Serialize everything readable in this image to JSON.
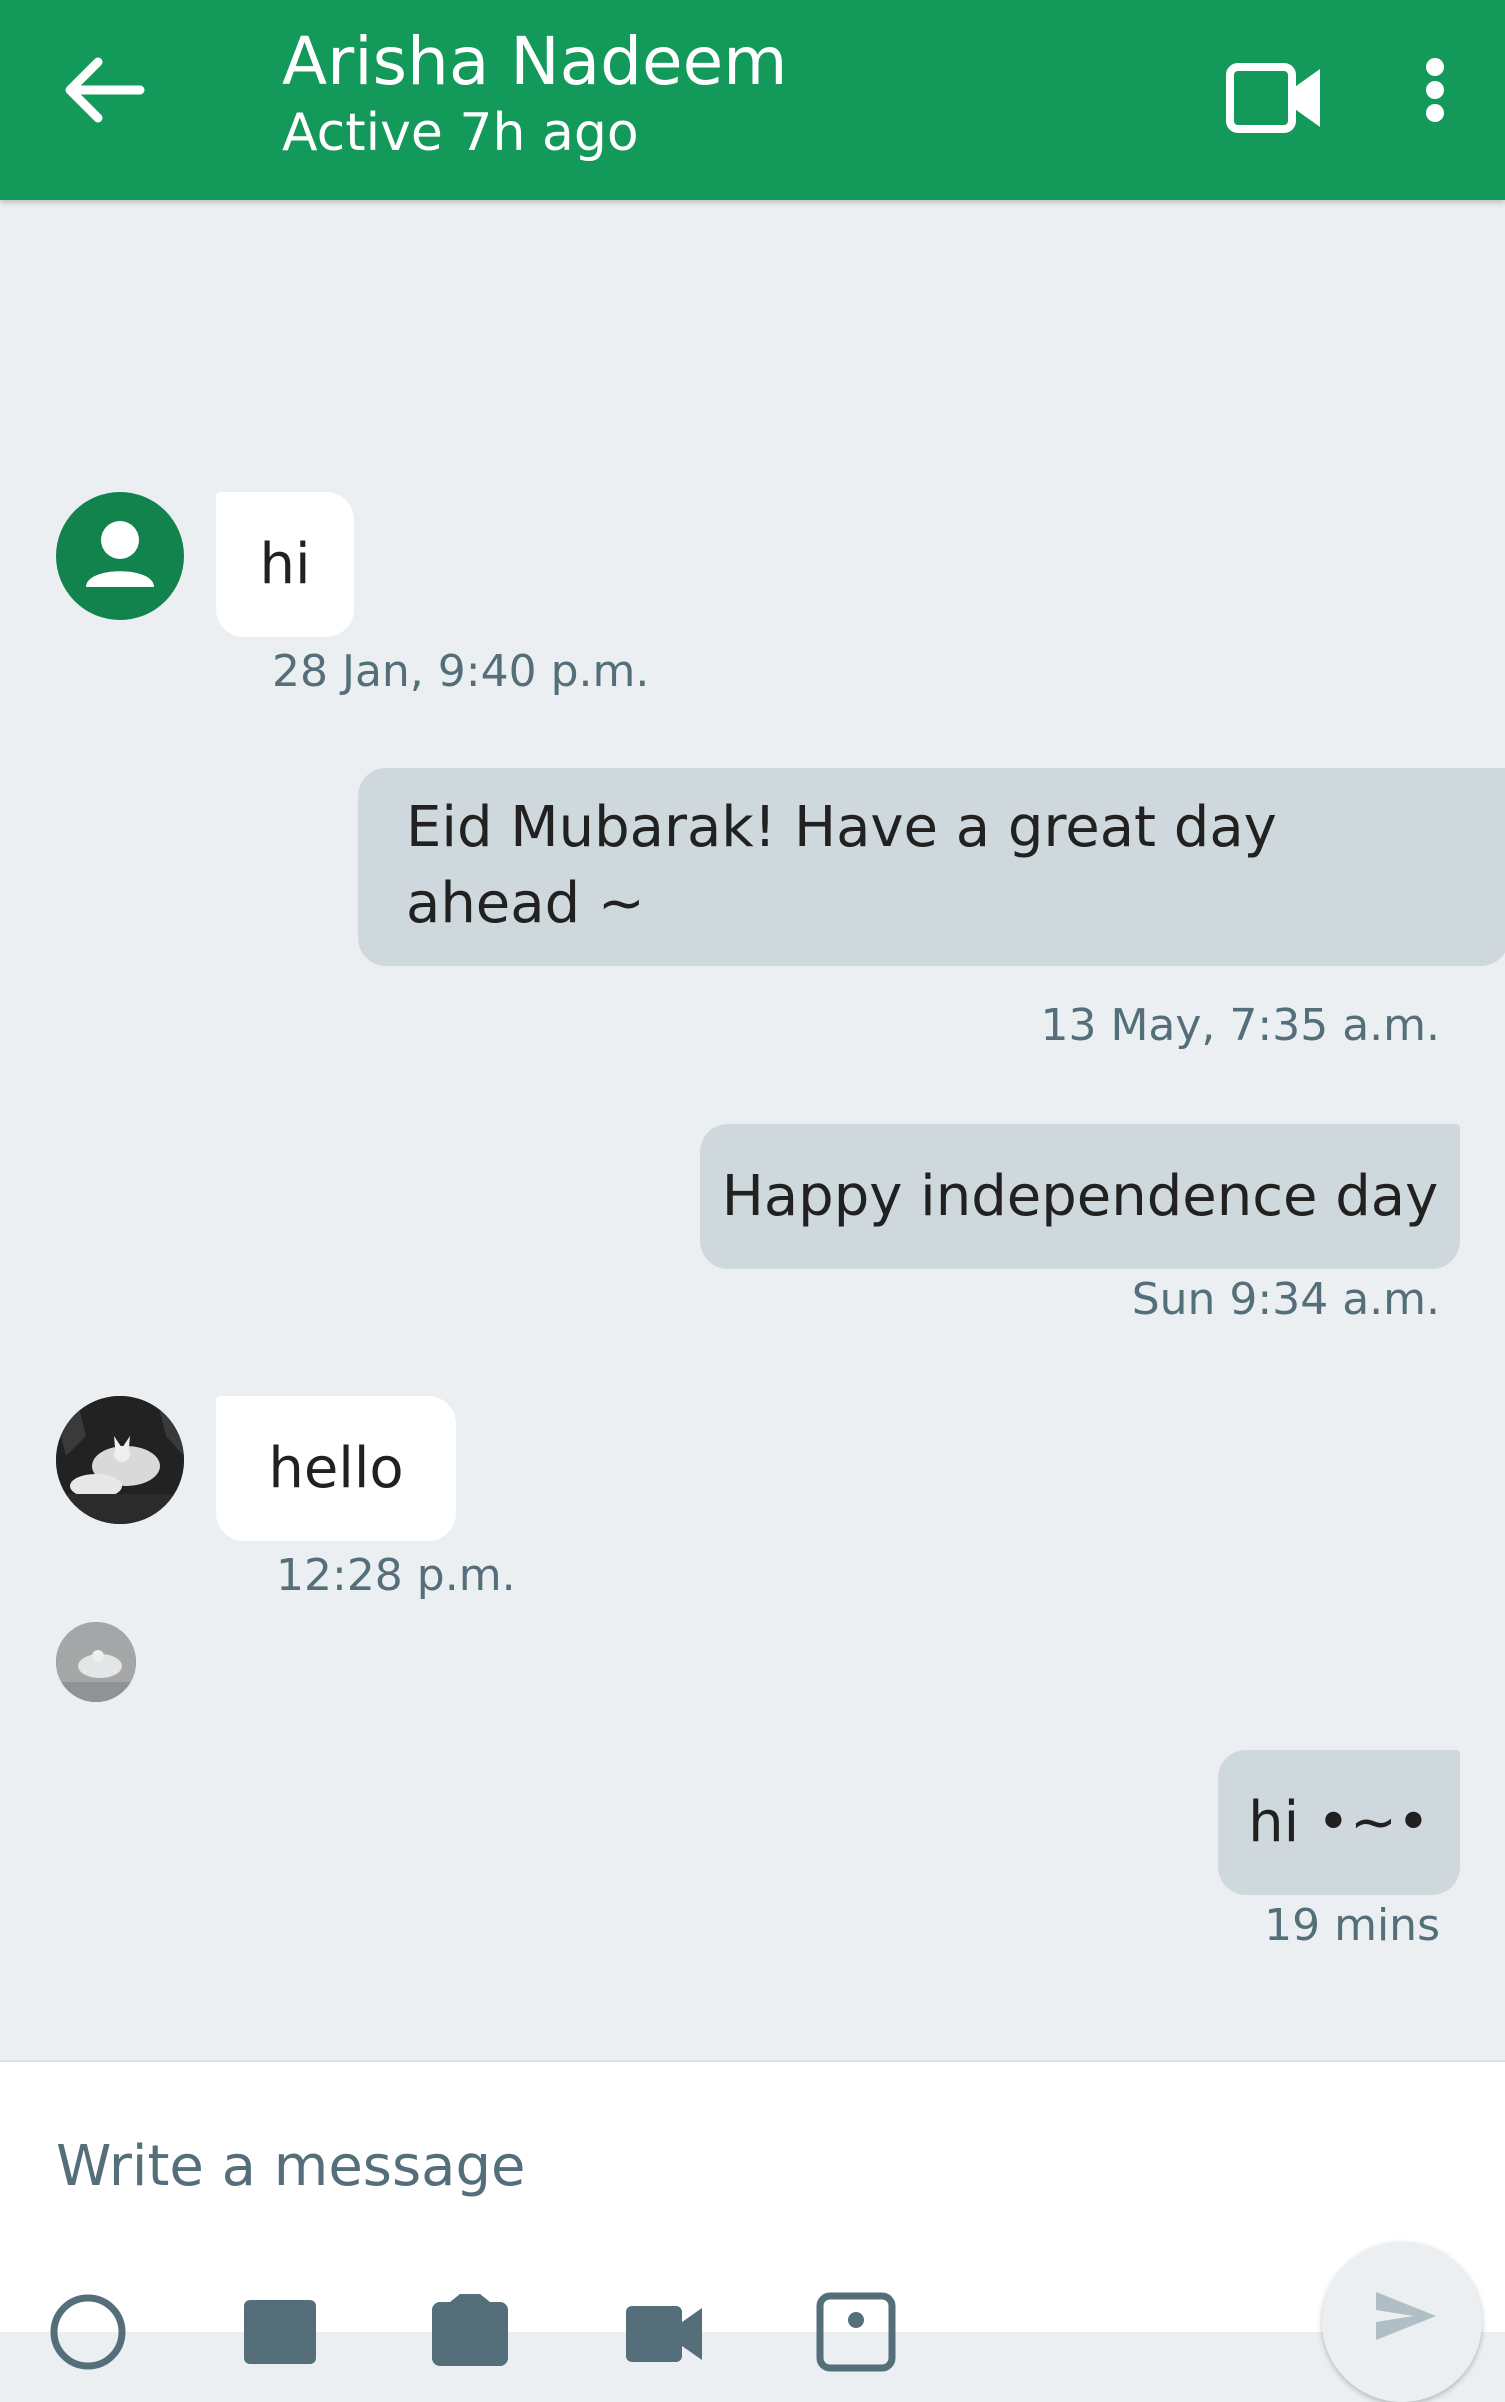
{
  "header": {
    "title": "Arisha Nadeem",
    "status": "Active 7h ago",
    "icons": [
      "back-arrow-icon",
      "video-call-icon",
      "more-vert-icon"
    ],
    "background_color": "#13995a"
  },
  "messages": [
    {
      "direction": "incoming",
      "text": "hi",
      "time": "28 Jan, 9:40 p.m.",
      "avatar": "person-avatar-icon"
    },
    {
      "direction": "outgoing",
      "text": "Eid Mubarak! Have a great day ahead ~",
      "time": "13 May, 7:35 a.m."
    },
    {
      "direction": "outgoing",
      "text": "Happy independence day",
      "time": "Sun 9:34 a.m."
    },
    {
      "direction": "incoming",
      "text": "hello",
      "time": "12:28 p.m.",
      "avatar": "wolf-photo-avatar"
    },
    {
      "direction": "outgoing",
      "text": "hi •~•",
      "time": "19 mins"
    }
  ],
  "composer": {
    "placeholder": "Write a message",
    "icons": [
      "emoji-icon",
      "gallery-icon",
      "camera-icon",
      "video-icon",
      "contact-icon",
      "send-icon"
    ]
  },
  "colors": {
    "incoming_bubble": "#ffffff",
    "outgoing_bubble": "#cfd8dc",
    "background": "#eceff1",
    "timestamp": "#546e7a"
  }
}
